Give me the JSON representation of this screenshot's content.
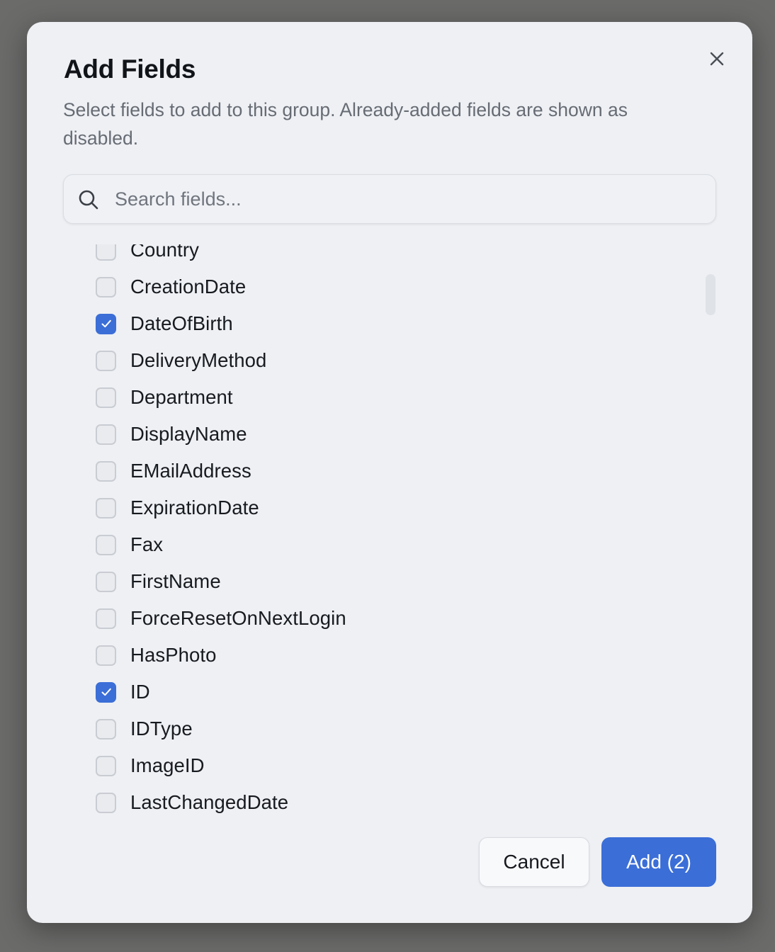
{
  "dialog": {
    "title": "Add Fields",
    "description": "Select fields to add to this group. Already-added fields are shown as disabled.",
    "close_icon": "close-icon"
  },
  "search": {
    "placeholder": "Search fields...",
    "value": "",
    "icon": "search-icon"
  },
  "fields": [
    {
      "label": "Country",
      "checked": false
    },
    {
      "label": "CreationDate",
      "checked": false
    },
    {
      "label": "DateOfBirth",
      "checked": true
    },
    {
      "label": "DeliveryMethod",
      "checked": false
    },
    {
      "label": "Department",
      "checked": false
    },
    {
      "label": "DisplayName",
      "checked": false
    },
    {
      "label": "EMailAddress",
      "checked": false
    },
    {
      "label": "ExpirationDate",
      "checked": false
    },
    {
      "label": "Fax",
      "checked": false
    },
    {
      "label": "FirstName",
      "checked": false
    },
    {
      "label": "ForceResetOnNextLogin",
      "checked": false
    },
    {
      "label": "HasPhoto",
      "checked": false
    },
    {
      "label": "ID",
      "checked": true
    },
    {
      "label": "IDType",
      "checked": false
    },
    {
      "label": "ImageID",
      "checked": false
    },
    {
      "label": "LastChangedDate",
      "checked": false
    }
  ],
  "footer": {
    "cancel_label": "Cancel",
    "add_label": "Add (2)"
  },
  "colors": {
    "accent": "#3b6ed7",
    "dialog_bg": "#eef0f4",
    "overlay": "#6b6b6a"
  }
}
